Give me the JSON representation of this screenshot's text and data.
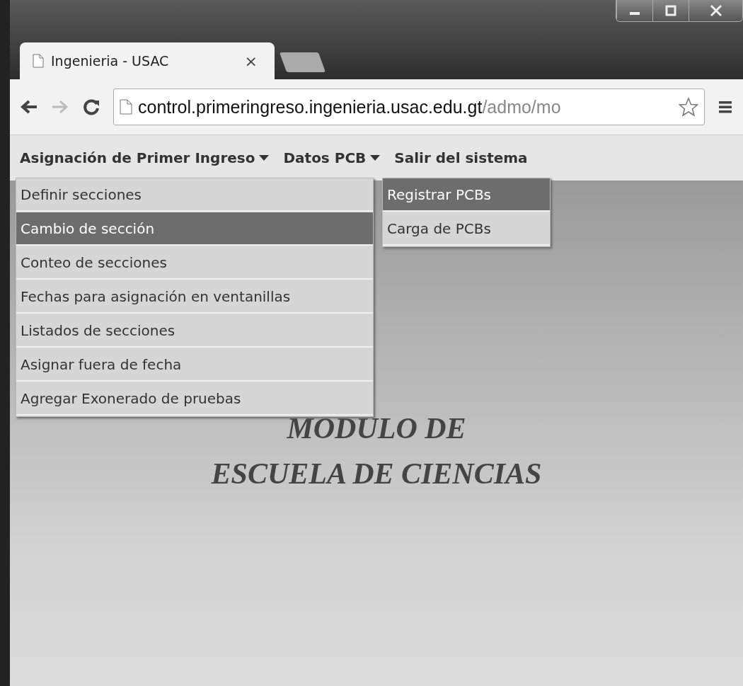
{
  "browser": {
    "tab": {
      "title": "Ingenieria - USAC",
      "close": "×"
    },
    "address": {
      "host": "control.primeringreso.ingenieria.usac.edu.gt",
      "path": "/admo/mo"
    }
  },
  "menu": [
    {
      "label": "Asignación de Primer Ingreso",
      "kind": "dropdown",
      "expanded": true,
      "items": [
        {
          "label": "Definir secciones",
          "selected": false
        },
        {
          "label": "Cambio de sección",
          "selected": true
        },
        {
          "label": "Conteo de secciones",
          "selected": false
        },
        {
          "label": "Fechas para asignación en ventanillas",
          "selected": false
        },
        {
          "label": "Listados de secciones",
          "selected": false
        },
        {
          "label": "Asignar fuera de fecha",
          "selected": false
        },
        {
          "label": "Agregar Exonerado de pruebas",
          "selected": false
        }
      ]
    },
    {
      "label": "Datos PCB",
      "kind": "dropdown",
      "expanded": true,
      "items": [
        {
          "label": "Registrar PCBs",
          "selected": true
        },
        {
          "label": "Carga de PCBs",
          "selected": false
        }
      ]
    },
    {
      "label": "Salir del sistema",
      "kind": "link"
    }
  ],
  "heading": {
    "lines": [
      "MODULO DE",
      "ESCUELA DE CIENCIAS"
    ]
  }
}
